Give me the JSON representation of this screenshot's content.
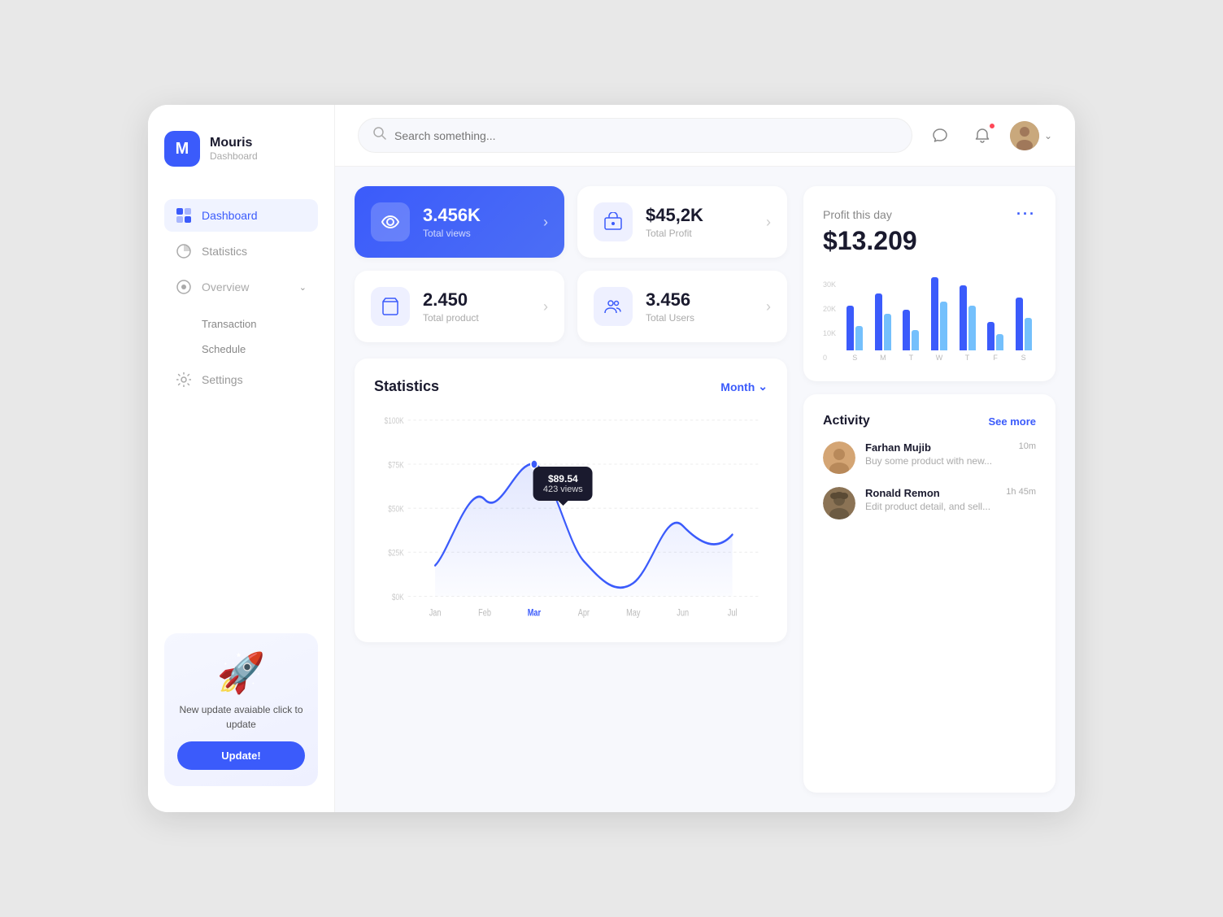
{
  "app": {
    "name": "Mouris",
    "subtitle": "Dashboard",
    "logo_letter": "M"
  },
  "header": {
    "search_placeholder": "Search something..."
  },
  "sidebar": {
    "nav_items": [
      {
        "id": "dashboard",
        "label": "Dashboard",
        "active": true
      },
      {
        "id": "statistics",
        "label": "Statistics",
        "active": false
      },
      {
        "id": "overview",
        "label": "Overview",
        "active": false
      }
    ],
    "sub_items": [
      "Transaction",
      "Schedule"
    ],
    "settings_label": "Settings",
    "update_card": {
      "text": "New update avaiable click to update",
      "button_label": "Update!"
    }
  },
  "stat_cards": [
    {
      "id": "views",
      "value": "3.456K",
      "label": "Total views",
      "primary": true
    },
    {
      "id": "profit",
      "value": "$45,2K",
      "label": "Total Profit",
      "primary": false
    },
    {
      "id": "product",
      "value": "2.450",
      "label": "Total product",
      "primary": false
    },
    {
      "id": "users",
      "value": "3.456",
      "label": "Total Users",
      "primary": false
    }
  ],
  "statistics": {
    "title": "Statistics",
    "filter_label": "Month",
    "tooltip": {
      "value": "$89.54",
      "sub": "423 views"
    },
    "y_labels": [
      "$100K",
      "$75K",
      "$50K",
      "$25K",
      "$0K"
    ],
    "x_labels": [
      "Jan",
      "Feb",
      "Mar",
      "Apr",
      "May",
      "Jun",
      "Jul"
    ]
  },
  "profit_widget": {
    "title": "Profit this day",
    "value": "$13.209",
    "days": [
      "S",
      "M",
      "T",
      "W",
      "T",
      "F",
      "S"
    ],
    "y_labels": [
      "30K",
      "20K",
      "10K",
      "0"
    ],
    "bars": [
      {
        "blue": 55,
        "cyan": 30
      },
      {
        "blue": 70,
        "cyan": 45
      },
      {
        "blue": 50,
        "cyan": 25
      },
      {
        "blue": 90,
        "cyan": 60
      },
      {
        "blue": 80,
        "cyan": 55
      },
      {
        "blue": 35,
        "cyan": 20
      },
      {
        "blue": 65,
        "cyan": 40
      }
    ]
  },
  "activity": {
    "title": "Activity",
    "see_more_label": "See more",
    "items": [
      {
        "name": "Farhan Mujib",
        "desc": "Buy some product with new...",
        "time": "10m"
      },
      {
        "name": "Ronald Remon",
        "desc": "Edit product detail, and sell...",
        "time": "1h 45m"
      }
    ]
  }
}
